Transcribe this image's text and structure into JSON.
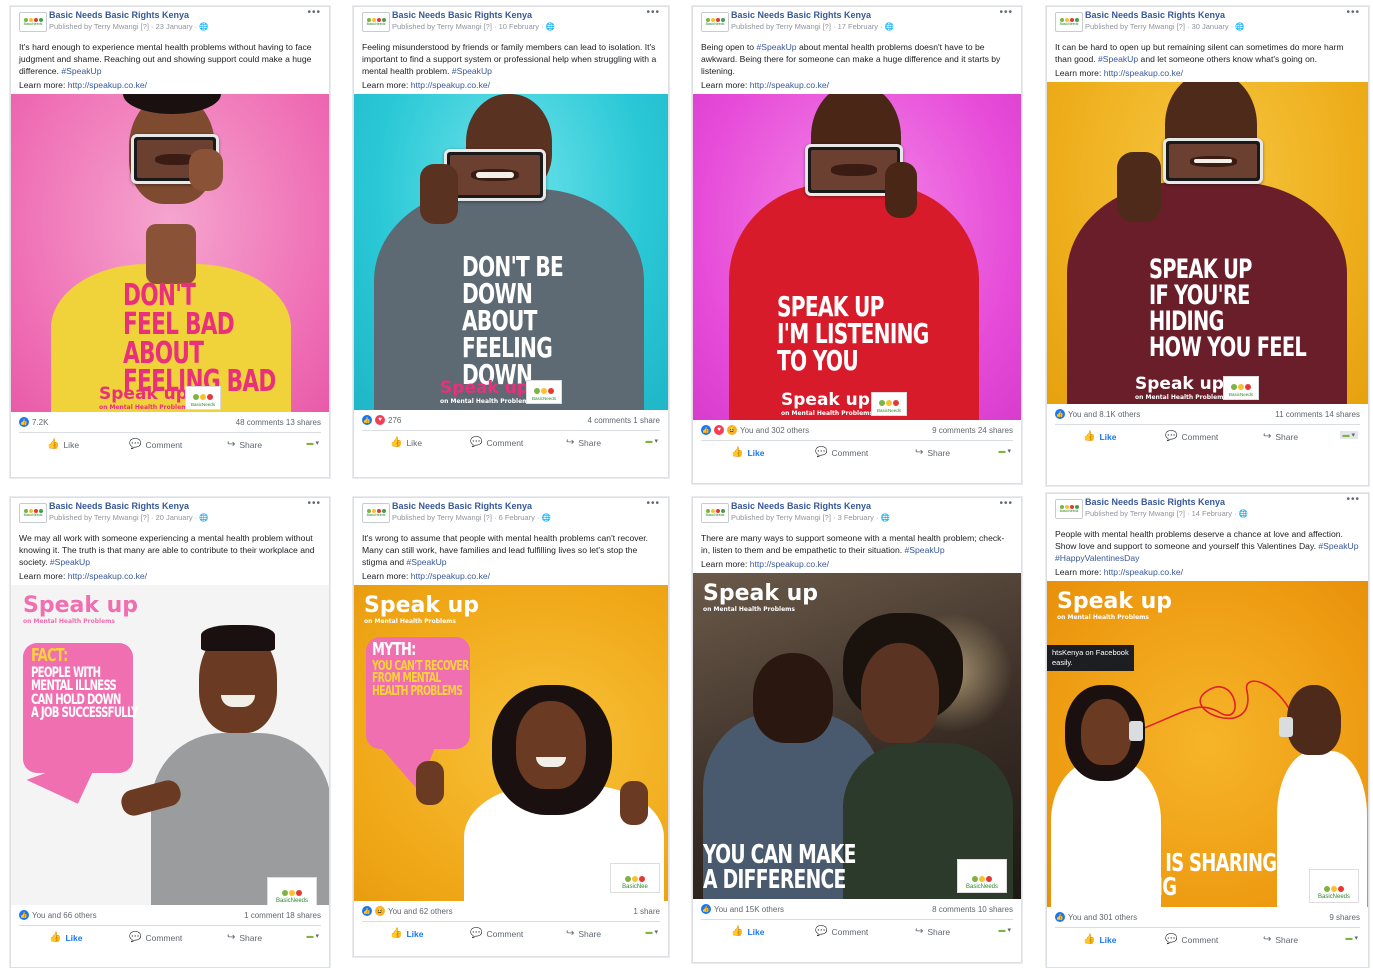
{
  "colors": {
    "link": "#385898",
    "like_blue": "#1877f2",
    "muted": "#606770"
  },
  "common": {
    "page_name": "Basic Needs Basic Rights Kenya",
    "learn_prefix": "Learn more: ",
    "learn_url": "http://speakup.co.ke/",
    "like": "Like",
    "comment": "Comment",
    "share": "Share",
    "more": "•••",
    "logo_text": "BasicNeeds",
    "brand_name": "Speak up",
    "brand_sub": "on Mental Health Problems",
    "badge_text": "BasicNeeds"
  },
  "posts": [
    {
      "meta": "Published by Terry Mwangi [?] · 23 January · 🌐",
      "text": "It's hard enough to experience mental health problems without having to face judgment and shame. Reaching out and showing support could make a huge difference.",
      "tags": " #SpeakUp",
      "poster": "DON'T\nFEEL BAD\nABOUT\nFEELING BAD",
      "reactions": "7.2K",
      "comments_shares": "48 comments  13 shares",
      "liked": false
    },
    {
      "meta": "Published by Terry Mwangi [?] · 10 February · 🌐",
      "text": "Feeling misunderstood by friends or family members can lead to isolation. It's important to find a support system or professional help when struggling with a mental health problem.",
      "tags": " #SpeakUp",
      "poster": "DON'T BE\nDOWN\nABOUT\nFEELING\nDOWN",
      "reactions": "276",
      "comments_shares": "4 comments  1 share",
      "liked": false
    },
    {
      "meta": "Published by Terry Mwangi [?] · 17 February · 🌐",
      "text": "Being open to ",
      "text_tag": "#SpeakUp",
      "text2": " about mental health problems doesn't have to be awkward. Being there for someone can make a huge difference and it starts by listening.",
      "poster": "SPEAK UP\nI'M LISTENING\nTO YOU",
      "reactions": "You and 302 others",
      "comments_shares": "9 comments  24 shares",
      "liked": true
    },
    {
      "meta": "Published by Terry Mwangi [?] · 30 January · 🌐",
      "text": "It can be hard to open up but remaining silent can sometimes do more harm than good. ",
      "text_tag": "#SpeakUp",
      "text2": " and let someone others know what's going on.",
      "poster": "SPEAK UP\nIF YOU'RE\nHIDING\nHOW YOU FEEL",
      "reactions": "You and 8.1K others",
      "comments_shares": "11 comments  14 shares",
      "liked": true
    },
    {
      "meta": "Published by Terry Mwangi [?] · 20 January · 🌐",
      "text": "We may all work with someone experiencing a mental health problem without knowing it. The truth is that many are able to contribute to their workplace and society.",
      "tags": " #SpeakUp",
      "bubble_head": "FACT:",
      "poster": "PEOPLE WITH\nMENTAL ILLNESS\nCAN HOLD DOWN\nA JOB SUCCESSFULLY",
      "reactions": "You and 66 others",
      "comments_shares": "1 comment  18 shares",
      "liked": true
    },
    {
      "meta": "Published by Terry Mwangi [?] · 6 February · 🌐",
      "text": "It's wrong to assume that people with mental health problems can't recover. Many can still work, have families and lead fulfilling lives so let's stop the stigma and",
      "tags": " #SpeakUp",
      "bubble_head": "MYTH:",
      "poster": "YOU CAN'T RECOVER\nFROM MENTAL\nHEALTH PROBLEMS",
      "reactions": "You and 62 others",
      "comments_shares": "1 share",
      "liked": true,
      "badge_text": "BasicNee"
    },
    {
      "meta": "Published by Terry Mwangi [?] · 3 February · 🌐",
      "text": "There are many ways to support someone with a mental health problem; check-in, listen to them and be empathetic to their situation.",
      "tags": " #SpeakUp",
      "poster": "YOU CAN MAKE\nA DIFFERENCE",
      "reactions": "You and 15K others",
      "comments_shares": "8 comments  10 shares",
      "liked": true
    },
    {
      "meta": "Published by Terry Mwangi [?] · 14 February · 🌐",
      "text": "People with mental health problems deserve a chance at love and affection. Show love and support to someone and yourself this Valentines Day.",
      "tags": " #SpeakUp #HappyValentinesDay",
      "poster": "TRUE LOVE IS SHARING\n& LISTENING",
      "tooltip": "htsKenya on Facebook\neasily.",
      "reactions": "You and 301 others",
      "comments_shares": "9 shares",
      "liked": true
    }
  ]
}
